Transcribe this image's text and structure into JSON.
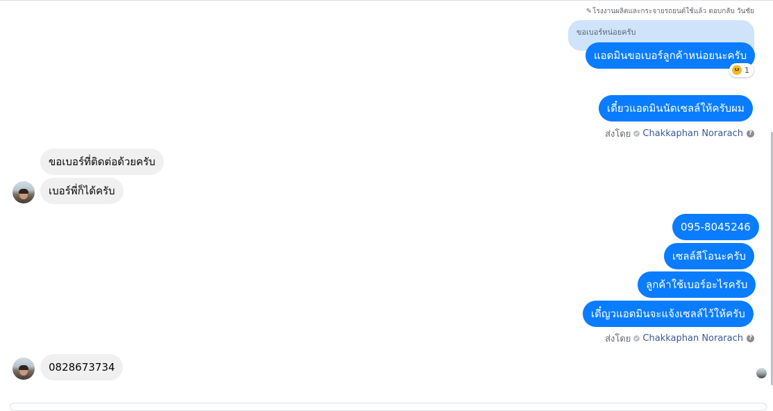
{
  "reply_context": {
    "header": "โรงงานผลิตและกระจายรถยนต์ใช้แล้ว ตอบกลับ วันชัย",
    "quoted_text": "ขอเบอร์หน่อยครับ"
  },
  "messages": {
    "m1": "แอดมินขอเบอร์ลูกค้าหน่อยนะครับ",
    "m1_reaction_count": "1",
    "m2": "เดี๋ยวแอดมินนัดเซลล์ให้ครับผม",
    "in1": "ขอเบอร์ที่ติดต่อด้วยครับ",
    "in2": "เบอร์พี่ก็ได้ครับ",
    "m3": "095-8045246",
    "m4": "เซลล์ลีโอนะครับ",
    "m5": "ลูกค้าใช้เบอร์อะไรครับ",
    "m6": "เดี๋ญวแอดมินจะแจ้งเซลล์ไว้ให้ครับ",
    "in3": "0828673734"
  },
  "sent_by": {
    "prefix": "ส่งโดย",
    "name": "Chakkaphan Norarach",
    "help_glyph": "?"
  },
  "icons": {
    "reaction": "sad-face-icon",
    "verified": "check-circle-icon",
    "help": "question-circle-icon"
  },
  "colors": {
    "outgoing_bubble": "#0a7cff",
    "incoming_bubble": "#f0f0f0",
    "quoted_bubble": "#cfe4fb",
    "sender_name": "#385898"
  }
}
